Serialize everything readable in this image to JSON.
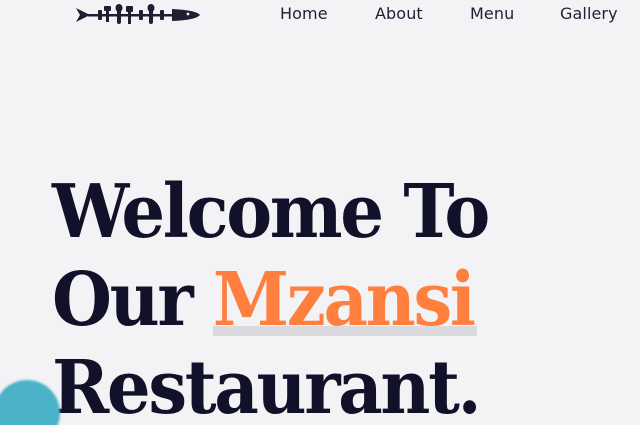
{
  "nav": {
    "logo_icon": "fish-cutlery-logo-icon",
    "items": [
      {
        "label": "Home"
      },
      {
        "label": "About"
      },
      {
        "label": "Menu"
      },
      {
        "label": "Gallery"
      }
    ]
  },
  "hero": {
    "line1": "Welcome To",
    "line2_prefix": "Our ",
    "highlight": "Mzansi",
    "line3": "Restaurant."
  },
  "colors": {
    "background": "#f3f2f5",
    "heading": "#11112a",
    "accent": "#ff7f3f",
    "blob": "#4ab3c8"
  }
}
